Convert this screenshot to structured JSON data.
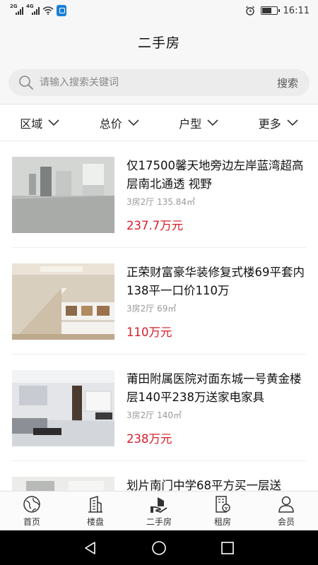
{
  "status_bar": {
    "signal1": "2G",
    "signal2": "4G",
    "time": "16:11",
    "battery_level": 0.6
  },
  "header": {
    "title": "二手房"
  },
  "search": {
    "placeholder": "请输入搜索关键词",
    "button_label": "搜索"
  },
  "filters": [
    {
      "label": "区域",
      "icon": "chevron-down-icon"
    },
    {
      "label": "总价",
      "icon": "chevron-down-icon"
    },
    {
      "label": "户型",
      "icon": "chevron-down-icon"
    },
    {
      "label": "更多",
      "icon": "chevron-down-icon"
    }
  ],
  "listings": [
    {
      "title": "仅17500馨天地旁边左岸蓝湾超高层南北通透 视野",
      "meta": "3房2厅 135.84㎡",
      "price": "237.7万元",
      "image": "empty-room-photo"
    },
    {
      "title": "正荣财富豪华装修复式楼69平套内138平一口价110万",
      "meta": "3房2厅 69㎡",
      "price": "110万元",
      "image": "staircase-photo"
    },
    {
      "title": "莆田附属医院对面东城一号黄金楼层140平238万送家电家具",
      "meta": "3房2厅 140㎡",
      "price": "238万元",
      "image": "living-room-photo"
    },
    {
      "title": "划片南门中学68平方买一层送",
      "meta": "",
      "price": "",
      "image": "interior-photo"
    }
  ],
  "tabs": [
    {
      "label": "首页",
      "icon": "globe-icon",
      "active": false
    },
    {
      "label": "楼盘",
      "icon": "building-icon",
      "active": false
    },
    {
      "label": "二手房",
      "icon": "hand-house-icon",
      "active": true
    },
    {
      "label": "租房",
      "icon": "rent-icon",
      "active": false
    },
    {
      "label": "会员",
      "icon": "user-icon",
      "active": false
    }
  ],
  "colors": {
    "price": "#d81e2a",
    "tab_bg": "#fbfbfb",
    "header_bg": "#f7f7f7"
  }
}
